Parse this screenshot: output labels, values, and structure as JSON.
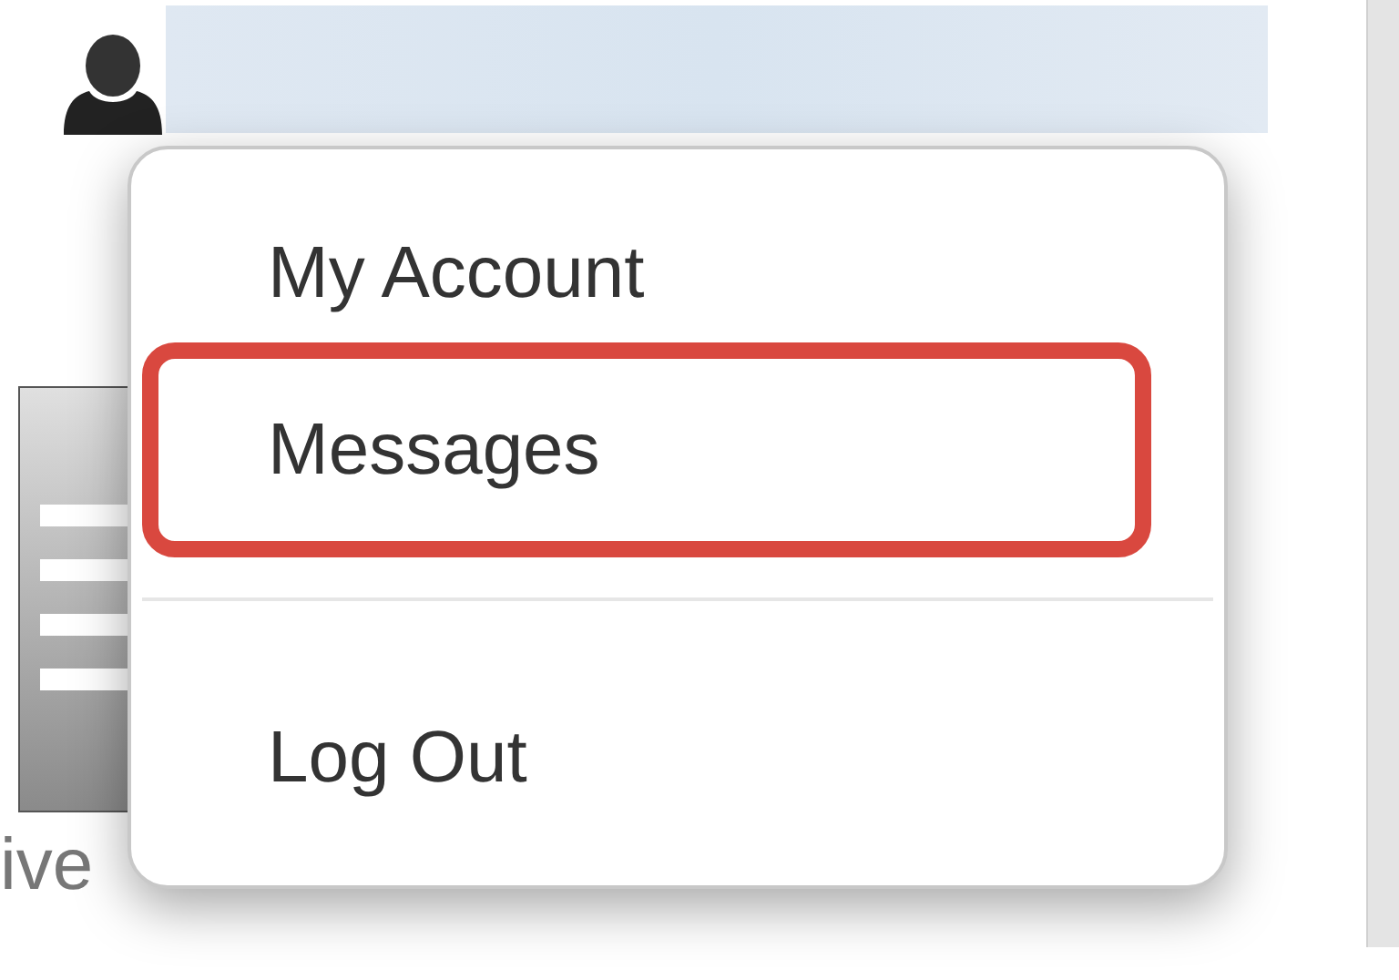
{
  "background_tile": {
    "label": "ive"
  },
  "menu": {
    "items": [
      {
        "label": "My Account",
        "highlighted": false,
        "separator_before": false
      },
      {
        "label": "Messages",
        "highlighted": true,
        "separator_before": false
      },
      {
        "label": "Log Out",
        "highlighted": false,
        "separator_before": true
      }
    ]
  }
}
